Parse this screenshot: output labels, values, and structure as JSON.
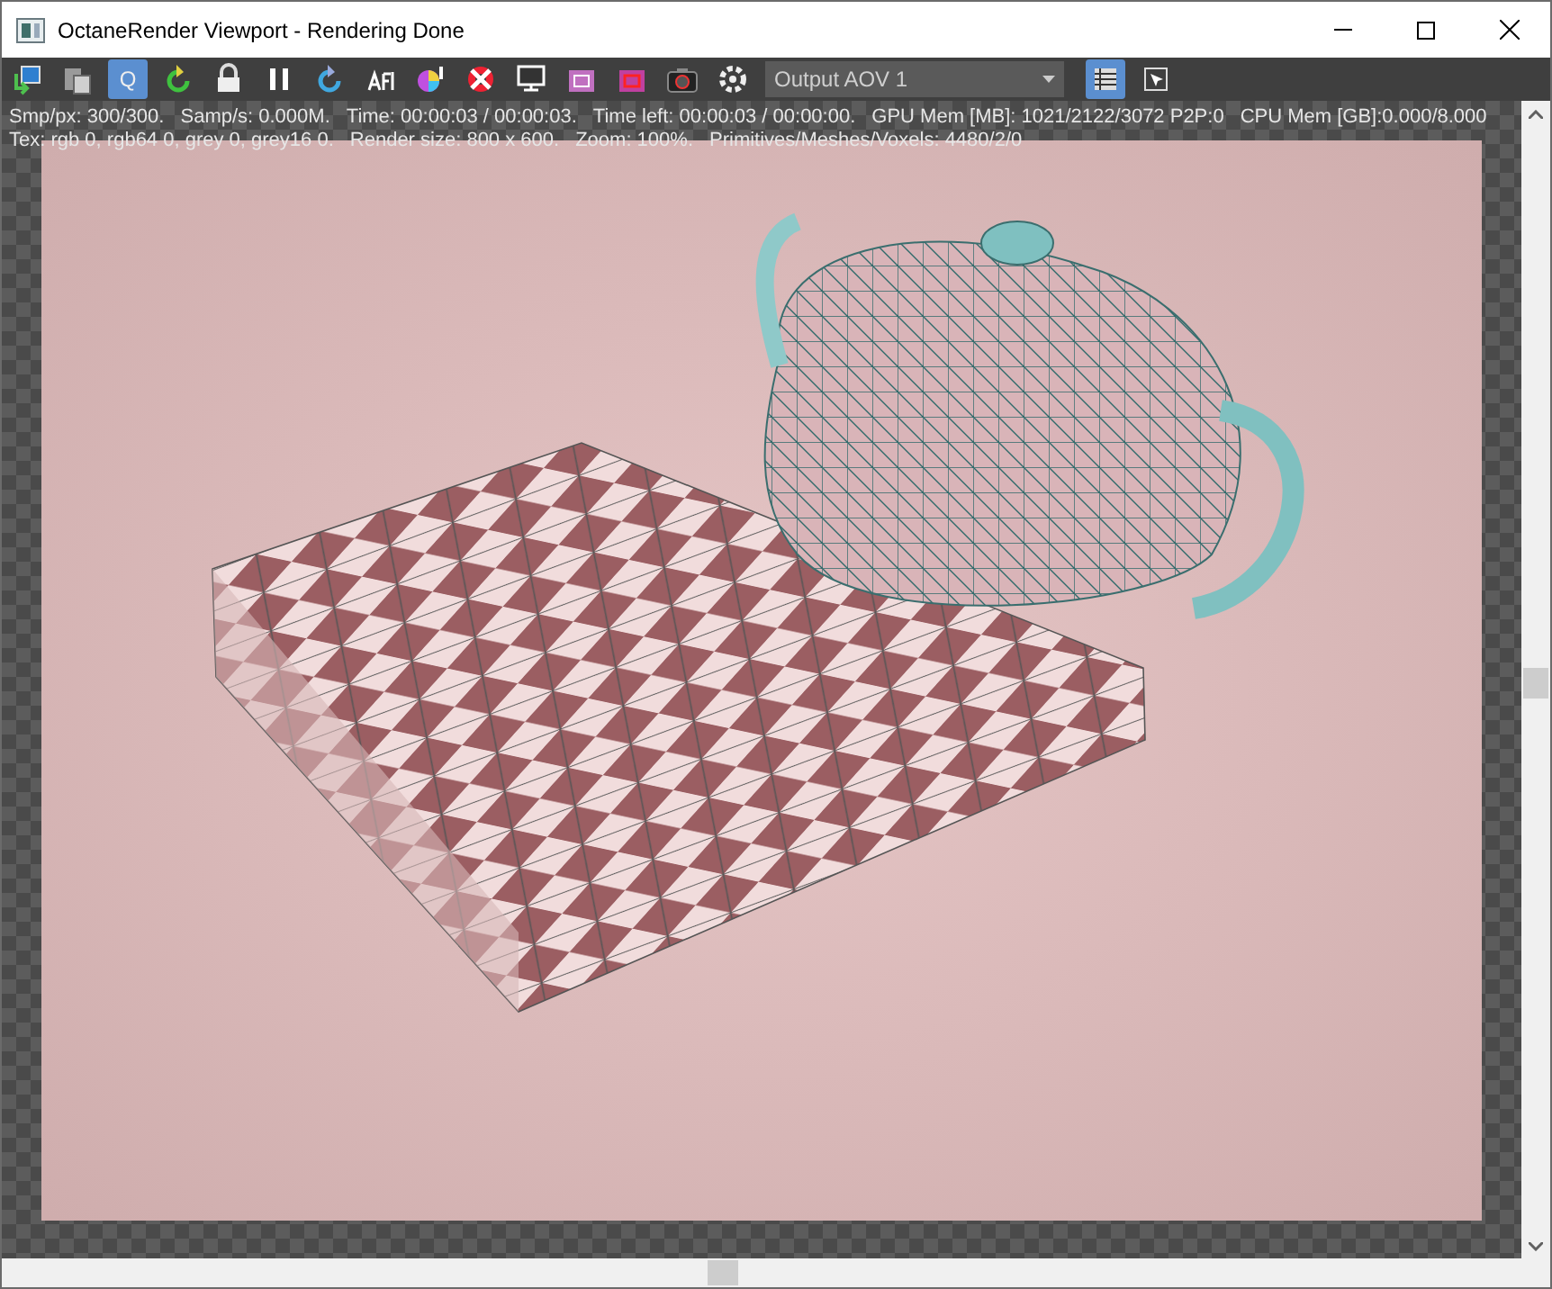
{
  "window": {
    "title": "OctaneRender Viewport - Rendering Done"
  },
  "toolbar": {
    "buttons": [
      {
        "kind": "import",
        "selected": false
      },
      {
        "kind": "clipboard",
        "selected": false
      },
      {
        "kind": "letter",
        "label": "Q",
        "selected": true
      },
      {
        "kind": "restart",
        "selected": false
      },
      {
        "kind": "lock",
        "selected": false
      },
      {
        "kind": "pause",
        "selected": false
      },
      {
        "kind": "reset",
        "selected": false
      },
      {
        "kind": "afi",
        "selected": false
      },
      {
        "kind": "colorwheel",
        "selected": false
      },
      {
        "kind": "target",
        "selected": false
      },
      {
        "kind": "monitor",
        "selected": false
      },
      {
        "kind": "region",
        "selected": false
      },
      {
        "kind": "region-red",
        "selected": false
      },
      {
        "kind": "camera",
        "selected": false
      },
      {
        "kind": "gear",
        "selected": false
      }
    ],
    "dropdown": {
      "value": "Output AOV 1"
    },
    "view_buttons": [
      {
        "kind": "list",
        "selected": true
      },
      {
        "kind": "pick",
        "selected": false
      }
    ]
  },
  "status": {
    "lines": [
      [
        "Smp/px: 300/300.",
        "Samp/s: 0.000M.",
        "Time: 00:00:03 / 00:00:03.",
        "Time left: 00:00:03 / 00:00:00.",
        "GPU Mem [MB]: 1021/2122/3072 P2P:0",
        "CPU Mem [GB]:0.000/8.000"
      ],
      [
        "Tex: rgb 0, rgb64 0, grey 0, grey16 0.",
        "Render size: 800 x 600.",
        "Zoom: 100%.",
        "Primitives/Meshes/Voxels: 4480/2/0"
      ]
    ]
  }
}
